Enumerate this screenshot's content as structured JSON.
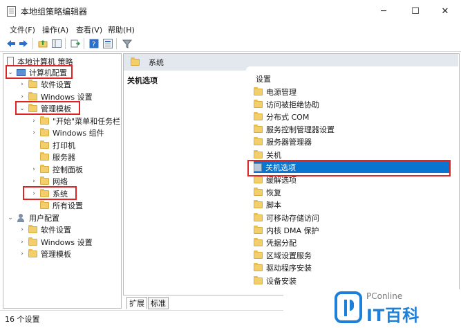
{
  "window": {
    "title": "本地组策略编辑器",
    "minimize": "─",
    "maximize": "☐",
    "close": "✕"
  },
  "menu": {
    "file": "文件(F)",
    "action": "操作(A)",
    "view": "查看(V)",
    "help": "帮助(H)"
  },
  "tree": {
    "root": "本地计算机 策略",
    "computer_config": "计算机配置",
    "software_settings": "软件设置",
    "windows_settings": "Windows 设置",
    "admin_templates": "管理模板",
    "start_menu": "\"开始\"菜单和任务栏",
    "windows_components": "Windows 组件",
    "printers": "打印机",
    "servers": "服务器",
    "control_panel": "控制面板",
    "network": "网络",
    "system": "系统",
    "all_settings": "所有设置",
    "user_config": "用户配置",
    "u_software_settings": "软件设置",
    "u_windows_settings": "Windows 设置",
    "u_admin_templates": "管理模板"
  },
  "right": {
    "header": "系统",
    "description_title": "关机选项",
    "column_header": "设置",
    "items": [
      "电源管理",
      "访问被拒绝协助",
      "分布式 COM",
      "服务控制管理器设置",
      "服务器管理器",
      "关机",
      "关机选项",
      "缓解选项",
      "恢复",
      "脚本",
      "可移动存储访问",
      "内核 DMA 保护",
      "凭据分配",
      "区域设置服务",
      "驱动程序安装",
      "设备安装"
    ],
    "selected_index": 6
  },
  "tabs": {
    "extended": "扩展",
    "standard": "标准"
  },
  "status": {
    "text": "16 个设置"
  },
  "watermark": {
    "brand": "PConline",
    "name": "IT百科"
  }
}
